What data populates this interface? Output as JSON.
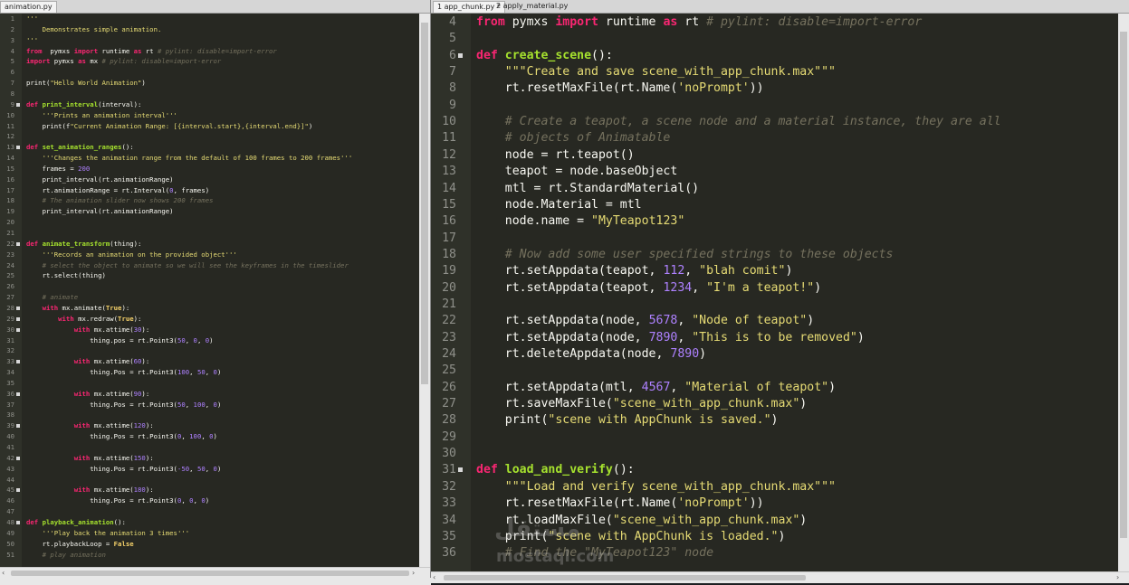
{
  "tabs_left": [
    {
      "label": "animation.py"
    }
  ],
  "tabs_right": [
    {
      "label": "1 app_chunk.py *"
    },
    {
      "label": "2 apply_material.py"
    }
  ],
  "left_code": [
    {
      "n": "1",
      "t": [
        [
          "s",
          "'''"
        ]
      ]
    },
    {
      "n": "2",
      "t": [
        [
          "s",
          "    Demonstrates simple animation."
        ]
      ]
    },
    {
      "n": "3",
      "t": [
        [
          "s",
          "'''"
        ]
      ]
    },
    {
      "n": "4",
      "t": [
        [
          "k",
          "from"
        ],
        [
          "",
          "  pymxs "
        ],
        [
          "k",
          "import"
        ],
        [
          "",
          " runtime "
        ],
        [
          "k",
          "as"
        ],
        [
          "",
          " rt "
        ],
        [
          "c",
          "# pylint: disable=import-error"
        ]
      ]
    },
    {
      "n": "5",
      "t": [
        [
          "k",
          "import"
        ],
        [
          "",
          " pymxs "
        ],
        [
          "k",
          "as"
        ],
        [
          "",
          " mx "
        ],
        [
          "c",
          "# pylint: disable=import-error"
        ]
      ]
    },
    {
      "n": "6",
      "t": []
    },
    {
      "n": "7",
      "t": [
        [
          "",
          "print("
        ],
        [
          "s",
          "\"Hello World Animation\""
        ],
        [
          "",
          ")"
        ]
      ]
    },
    {
      "n": "8",
      "t": []
    },
    {
      "n": "9",
      "fold": true,
      "t": [
        [
          "k",
          "def"
        ],
        [
          " ",
          ""
        ],
        [
          "f",
          " print_interval"
        ],
        [
          "",
          "(interval):"
        ]
      ]
    },
    {
      "n": "10",
      "t": [
        [
          "s",
          "    '''Prints an animation interval'''"
        ]
      ]
    },
    {
      "n": "11",
      "t": [
        [
          "",
          "    print(f"
        ],
        [
          "s",
          "\"Current Animation Range: [{interval.start},{interval.end}]\""
        ],
        [
          "",
          ")"
        ]
      ]
    },
    {
      "n": "12",
      "t": []
    },
    {
      "n": "13",
      "fold": true,
      "t": [
        [
          "k",
          "def"
        ],
        [
          "f",
          " set_animation_ranges"
        ],
        [
          "",
          "():"
        ]
      ]
    },
    {
      "n": "14",
      "t": [
        [
          "s",
          "    '''Changes the animation range from the default of 100 frames to 200 frames'''"
        ]
      ]
    },
    {
      "n": "15",
      "t": [
        [
          "",
          "    frames = "
        ],
        [
          "n",
          "200"
        ]
      ]
    },
    {
      "n": "16",
      "t": [
        [
          "",
          "    print_interval(rt.animationRange)"
        ]
      ]
    },
    {
      "n": "17",
      "t": [
        [
          "",
          "    rt.animationRange = rt.Interval("
        ],
        [
          "n",
          "0"
        ],
        [
          "",
          ", frames)"
        ]
      ]
    },
    {
      "n": "18",
      "t": [
        [
          "c",
          "    # The animation slider now shows 200 frames"
        ]
      ]
    },
    {
      "n": "19",
      "t": [
        [
          "",
          "    print_interval(rt.animationRange)"
        ]
      ]
    },
    {
      "n": "20",
      "t": []
    },
    {
      "n": "21",
      "t": []
    },
    {
      "n": "22",
      "fold": true,
      "t": [
        [
          "k",
          "def"
        ],
        [
          "f",
          " animate_transform"
        ],
        [
          "",
          "(thing):"
        ]
      ]
    },
    {
      "n": "23",
      "t": [
        [
          "s",
          "    '''Records an animation on the provided object'''"
        ]
      ]
    },
    {
      "n": "24",
      "t": [
        [
          "c",
          "    # select the object to animate so we will see the keyframes in the timeslider"
        ]
      ]
    },
    {
      "n": "25",
      "t": [
        [
          "",
          "    rt.select(thing)"
        ]
      ]
    },
    {
      "n": "26",
      "t": []
    },
    {
      "n": "27",
      "t": [
        [
          "c",
          "    # animate"
        ]
      ]
    },
    {
      "n": "28",
      "fold": true,
      "t": [
        [
          "k",
          "    with"
        ],
        [
          "",
          " mx.animate("
        ],
        [
          "kb",
          "True"
        ],
        [
          "",
          "):"
        ]
      ]
    },
    {
      "n": "29",
      "fold": true,
      "t": [
        [
          "k",
          "        with"
        ],
        [
          "",
          " mx.redraw("
        ],
        [
          "kb",
          "True"
        ],
        [
          "",
          "):"
        ]
      ]
    },
    {
      "n": "30",
      "fold": true,
      "t": [
        [
          "k",
          "            with"
        ],
        [
          "",
          " mx.attime("
        ],
        [
          "n",
          "30"
        ],
        [
          "",
          "):"
        ]
      ]
    },
    {
      "n": "31",
      "t": [
        [
          "",
          "                thing.pos = rt.Point3("
        ],
        [
          "n",
          "50"
        ],
        [
          "",
          ", "
        ],
        [
          "n",
          "0"
        ],
        [
          "",
          ", "
        ],
        [
          "n",
          "0"
        ],
        [
          "",
          ")"
        ]
      ]
    },
    {
      "n": "32",
      "t": []
    },
    {
      "n": "33",
      "fold": true,
      "t": [
        [
          "k",
          "            with"
        ],
        [
          "",
          " mx.attime("
        ],
        [
          "n",
          "60"
        ],
        [
          "",
          "):"
        ]
      ]
    },
    {
      "n": "34",
      "t": [
        [
          "",
          "                thing.Pos = rt.Point3("
        ],
        [
          "n",
          "100"
        ],
        [
          "",
          ", "
        ],
        [
          "n",
          "50"
        ],
        [
          "",
          ", "
        ],
        [
          "n",
          "0"
        ],
        [
          "",
          ")"
        ]
      ]
    },
    {
      "n": "35",
      "t": []
    },
    {
      "n": "36",
      "fold": true,
      "t": [
        [
          "k",
          "            with"
        ],
        [
          "",
          " mx.attime("
        ],
        [
          "n",
          "90"
        ],
        [
          "",
          "):"
        ]
      ]
    },
    {
      "n": "37",
      "t": [
        [
          "",
          "                thing.Pos = rt.Point3("
        ],
        [
          "n",
          "50"
        ],
        [
          "",
          ", "
        ],
        [
          "n",
          "100"
        ],
        [
          "",
          ", "
        ],
        [
          "n",
          "0"
        ],
        [
          "",
          ")"
        ]
      ]
    },
    {
      "n": "38",
      "t": []
    },
    {
      "n": "39",
      "fold": true,
      "t": [
        [
          "k",
          "            with"
        ],
        [
          "",
          " mx.attime("
        ],
        [
          "n",
          "120"
        ],
        [
          "",
          "):"
        ]
      ]
    },
    {
      "n": "40",
      "t": [
        [
          "",
          "                thing.Pos = rt.Point3("
        ],
        [
          "n",
          "0"
        ],
        [
          "",
          ", "
        ],
        [
          "n",
          "100"
        ],
        [
          "",
          ", "
        ],
        [
          "n",
          "0"
        ],
        [
          "",
          ")"
        ]
      ]
    },
    {
      "n": "41",
      "t": []
    },
    {
      "n": "42",
      "fold": true,
      "t": [
        [
          "k",
          "            with"
        ],
        [
          "",
          " mx.attime("
        ],
        [
          "n",
          "150"
        ],
        [
          "",
          "):"
        ]
      ]
    },
    {
      "n": "43",
      "t": [
        [
          "",
          "                thing.Pos = rt.Point3("
        ],
        [
          "n",
          "-50"
        ],
        [
          "",
          ", "
        ],
        [
          "n",
          "50"
        ],
        [
          "",
          ", "
        ],
        [
          "n",
          "0"
        ],
        [
          "",
          ")"
        ]
      ]
    },
    {
      "n": "44",
      "t": []
    },
    {
      "n": "45",
      "fold": true,
      "t": [
        [
          "k",
          "            with"
        ],
        [
          "",
          " mx.attime("
        ],
        [
          "n",
          "180"
        ],
        [
          "",
          "):"
        ]
      ]
    },
    {
      "n": "46",
      "t": [
        [
          "",
          "                thing.Pos = rt.Point3("
        ],
        [
          "n",
          "0"
        ],
        [
          "",
          ", "
        ],
        [
          "n",
          "0"
        ],
        [
          "",
          ", "
        ],
        [
          "n",
          "0"
        ],
        [
          "",
          ")"
        ]
      ]
    },
    {
      "n": "47",
      "t": []
    },
    {
      "n": "48",
      "fold": true,
      "t": [
        [
          "k",
          "def"
        ],
        [
          "f",
          " playback_animation"
        ],
        [
          "",
          "():"
        ]
      ]
    },
    {
      "n": "49",
      "t": [
        [
          "s",
          "    '''Play back the animation 3 times'''"
        ]
      ]
    },
    {
      "n": "50",
      "t": [
        [
          "",
          "    rt.playbackLoop = "
        ],
        [
          "kb",
          "False"
        ]
      ]
    },
    {
      "n": "51",
      "t": [
        [
          "c",
          "    # play animation"
        ]
      ]
    }
  ],
  "right_code": [
    {
      "n": "4",
      "t": [
        [
          "k",
          "from"
        ],
        [
          "",
          " pymxs "
        ],
        [
          "k",
          "import"
        ],
        [
          "",
          " runtime "
        ],
        [
          "k",
          "as"
        ],
        [
          "",
          " rt "
        ],
        [
          "c",
          "# pylint: disable=import-error"
        ]
      ]
    },
    {
      "n": "5",
      "t": []
    },
    {
      "n": "6",
      "fold": true,
      "t": [
        [
          "k",
          "def"
        ],
        [
          "f",
          " create_scene"
        ],
        [
          "",
          "():"
        ]
      ]
    },
    {
      "n": "7",
      "t": [
        [
          "s",
          "    \"\"\"Create and save scene_with_app_chunk.max\"\"\""
        ]
      ]
    },
    {
      "n": "8",
      "t": [
        [
          "",
          "    rt.resetMaxFile(rt.Name("
        ],
        [
          "s",
          "'noPrompt'"
        ],
        [
          "",
          "))"
        ]
      ]
    },
    {
      "n": "9",
      "t": []
    },
    {
      "n": "10",
      "t": [
        [
          "c",
          "    # Create a teapot, a scene node and a material instance, they are all"
        ]
      ]
    },
    {
      "n": "11",
      "t": [
        [
          "c",
          "    # objects of Animatable"
        ]
      ]
    },
    {
      "n": "12",
      "t": [
        [
          "",
          "    node = rt.teapot()"
        ]
      ]
    },
    {
      "n": "13",
      "t": [
        [
          "",
          "    teapot = node.baseObject"
        ]
      ]
    },
    {
      "n": "14",
      "t": [
        [
          "",
          "    mtl = rt.StandardMaterial()"
        ]
      ]
    },
    {
      "n": "15",
      "t": [
        [
          "",
          "    node.Material = mtl"
        ]
      ]
    },
    {
      "n": "16",
      "t": [
        [
          "",
          "    node.name = "
        ],
        [
          "s",
          "\"MyTeapot123\""
        ]
      ]
    },
    {
      "n": "17",
      "t": []
    },
    {
      "n": "18",
      "t": [
        [
          "c",
          "    # Now add some user specified strings to these objects"
        ]
      ]
    },
    {
      "n": "19",
      "t": [
        [
          "",
          "    rt.setAppdata(teapot, "
        ],
        [
          "n",
          "112"
        ],
        [
          "",
          ", "
        ],
        [
          "s",
          "\"blah comit\""
        ],
        [
          "",
          ")"
        ]
      ]
    },
    {
      "n": "20",
      "t": [
        [
          "",
          "    rt.setAppdata(teapot, "
        ],
        [
          "n",
          "1234"
        ],
        [
          "",
          ", "
        ],
        [
          "s",
          "\"I'm a teapot!\""
        ],
        [
          "",
          ")"
        ]
      ]
    },
    {
      "n": "21",
      "t": []
    },
    {
      "n": "22",
      "t": [
        [
          "",
          "    rt.setAppdata(node, "
        ],
        [
          "n",
          "5678"
        ],
        [
          "",
          ", "
        ],
        [
          "s",
          "\"Node of teapot\""
        ],
        [
          "",
          ")"
        ]
      ]
    },
    {
      "n": "23",
      "t": [
        [
          "",
          "    rt.setAppdata(node, "
        ],
        [
          "n",
          "7890"
        ],
        [
          "",
          ", "
        ],
        [
          "s",
          "\"This is to be removed\""
        ],
        [
          "",
          ")"
        ]
      ]
    },
    {
      "n": "24",
      "t": [
        [
          "",
          "    rt.deleteAppdata(node, "
        ],
        [
          "n",
          "7890"
        ],
        [
          "",
          ")"
        ]
      ]
    },
    {
      "n": "25",
      "t": []
    },
    {
      "n": "26",
      "t": [
        [
          "",
          "    rt.setAppdata(mtl, "
        ],
        [
          "n",
          "4567"
        ],
        [
          "",
          ", "
        ],
        [
          "s",
          "\"Material of teapot\""
        ],
        [
          "",
          ")"
        ]
      ]
    },
    {
      "n": "27",
      "t": [
        [
          "",
          "    rt.saveMaxFile("
        ],
        [
          "s",
          "\"scene_with_app_chunk.max\""
        ],
        [
          "",
          ")"
        ]
      ]
    },
    {
      "n": "28",
      "t": [
        [
          "",
          "    print("
        ],
        [
          "s",
          "\"scene with AppChunk is saved.\""
        ],
        [
          "",
          ")"
        ]
      ]
    },
    {
      "n": "29",
      "t": []
    },
    {
      "n": "30",
      "t": []
    },
    {
      "n": "31",
      "fold": true,
      "t": [
        [
          "k",
          "def"
        ],
        [
          "f",
          " load_and_verify"
        ],
        [
          "",
          "():"
        ]
      ]
    },
    {
      "n": "32",
      "t": [
        [
          "s",
          "    \"\"\"Load and verify scene_with_app_chunk.max\"\"\""
        ]
      ]
    },
    {
      "n": "33",
      "t": [
        [
          "",
          "    rt.resetMaxFile(rt.Name("
        ],
        [
          "s",
          "'noPrompt'"
        ],
        [
          "",
          "))"
        ]
      ]
    },
    {
      "n": "34",
      "t": [
        [
          "",
          "    rt.loadMaxFile("
        ],
        [
          "s",
          "\"scene_with_app_chunk.max\""
        ],
        [
          "",
          ")"
        ]
      ]
    },
    {
      "n": "35",
      "t": [
        [
          "",
          "    print("
        ],
        [
          "s",
          "\"scene with AppChunk is loaded.\""
        ],
        [
          "",
          ")"
        ]
      ]
    },
    {
      "n": "36",
      "t": [
        [
          "c",
          "    # Find the \"MyTeapot123\" node"
        ]
      ]
    }
  ],
  "watermark": {
    "line1": "مستقل",
    "line2": "mostaql.com"
  }
}
